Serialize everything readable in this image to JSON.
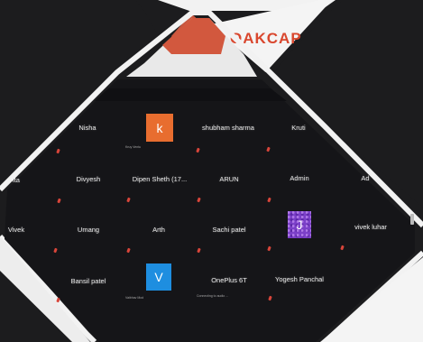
{
  "brand": {
    "text": "OAKCAP"
  },
  "participants": [
    {
      "name": "Nisha"
    },
    {
      "name": "k",
      "avatar_letter": "k",
      "status": "Kruy Ventu"
    },
    {
      "name": "shubham sharma"
    },
    {
      "name": "Kruti"
    },
    {
      "name": "ita"
    },
    {
      "name": "Divyesh"
    },
    {
      "name": "Dipen Sheth (17..."
    },
    {
      "name": "ARUN"
    },
    {
      "name": "Admin"
    },
    {
      "name": "Ad"
    },
    {
      "name": "Vivek"
    },
    {
      "name": "Umang"
    },
    {
      "name": "Arth"
    },
    {
      "name": "Sachi patel"
    },
    {
      "name": "J",
      "avatar_letter": "J"
    },
    {
      "name": "vivek luhar"
    },
    {
      "name": "Bansil patel"
    },
    {
      "name": "V",
      "avatar_letter": "V",
      "status": "Vaibhav Mod"
    },
    {
      "name": "OnePlus 6T",
      "status": "Connecting to audio ..."
    },
    {
      "name": "Yogesh Panchal"
    }
  ],
  "colors": {
    "accent_orange": "#e86d2f",
    "accent_blue": "#1e8ee0",
    "accent_purple": "#7b3fc8",
    "mic_muted": "#d8453a"
  }
}
